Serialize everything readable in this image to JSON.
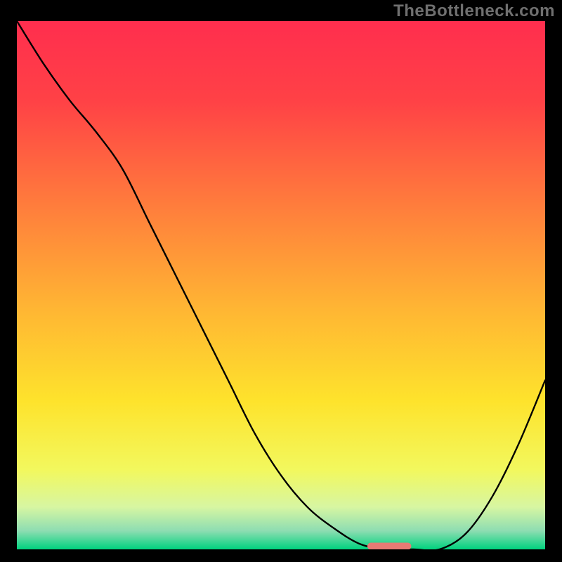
{
  "watermark": "TheBottleneck.com",
  "chart_data": {
    "type": "line",
    "title": "",
    "xlabel": "",
    "ylabel": "",
    "x": [
      0,
      0.05,
      0.1,
      0.15,
      0.2,
      0.25,
      0.3,
      0.35,
      0.4,
      0.45,
      0.5,
      0.55,
      0.6,
      0.65,
      0.7,
      0.75,
      0.8,
      0.85,
      0.9,
      0.95,
      1.0
    ],
    "series": [
      {
        "name": "bottleneck",
        "values": [
          1.0,
          0.92,
          0.85,
          0.79,
          0.72,
          0.62,
          0.52,
          0.42,
          0.32,
          0.22,
          0.14,
          0.08,
          0.04,
          0.01,
          0.0,
          0.0,
          0.0,
          0.03,
          0.1,
          0.2,
          0.32
        ]
      }
    ],
    "xlim": [
      0,
      1
    ],
    "ylim": [
      0,
      1
    ],
    "marker": {
      "x0": 0.67,
      "x1": 0.74,
      "y": 0.006,
      "color": "#e77a74",
      "width": 10
    },
    "gradient_stops": [
      {
        "offset": 0.0,
        "color": "#ff2e4e"
      },
      {
        "offset": 0.15,
        "color": "#ff4146"
      },
      {
        "offset": 0.35,
        "color": "#ff7d3c"
      },
      {
        "offset": 0.55,
        "color": "#ffb733"
      },
      {
        "offset": 0.72,
        "color": "#fee32c"
      },
      {
        "offset": 0.85,
        "color": "#f2f85e"
      },
      {
        "offset": 0.92,
        "color": "#d7f6a2"
      },
      {
        "offset": 0.965,
        "color": "#8dddb2"
      },
      {
        "offset": 1.0,
        "color": "#00d27e"
      }
    ]
  }
}
